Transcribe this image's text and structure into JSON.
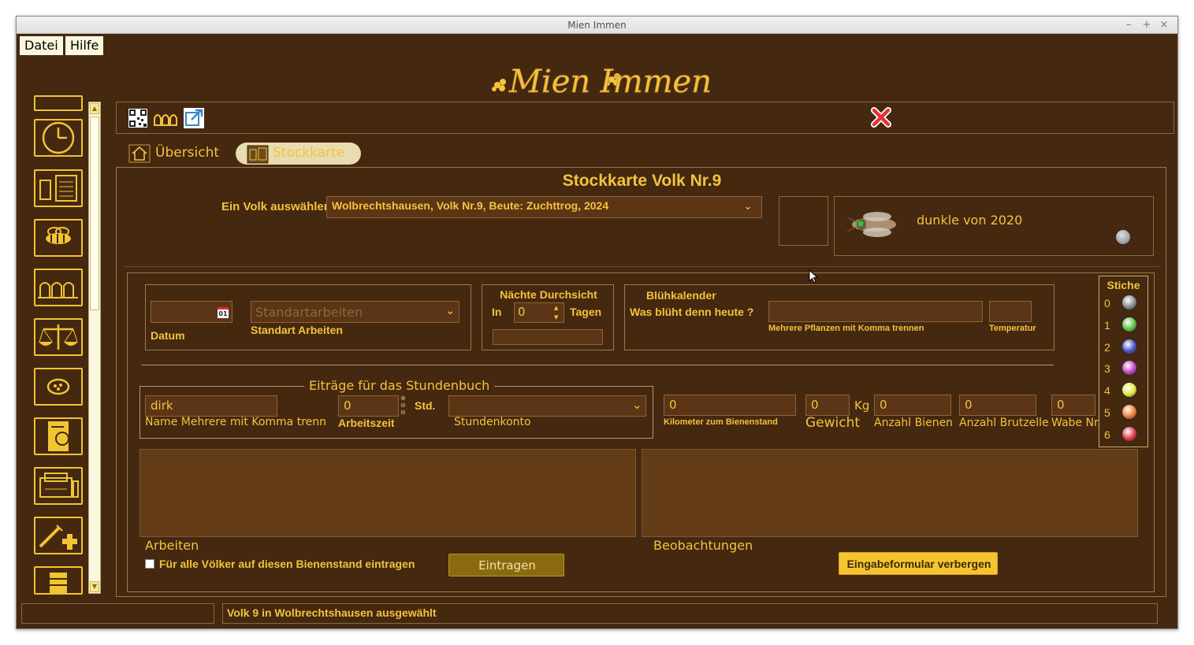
{
  "window": {
    "title": "Mien Immen",
    "min": "–",
    "max": "+",
    "close": "×"
  },
  "menu": {
    "file": "Datei",
    "help": "Hilfe"
  },
  "logo_text": "Mien Immen",
  "tabs": {
    "overview": "Übersicht",
    "stockcard": "Stockkarte"
  },
  "card": {
    "title": "Stockkarte Volk Nr.9",
    "select_label": "Ein Volk auswählen",
    "select_value": "Wolbrechtshausen, Volk Nr.9, Beute: Zuchttrog, 2024",
    "queen_label": "dunkle von 2020"
  },
  "form": {
    "date_label": "Datum",
    "date_icon_text": "01",
    "std_work_placeholder": "Standartarbeiten",
    "std_work_label": "Standart Arbeiten",
    "next_check_title": "Nächte Durchsicht",
    "in_label": "In",
    "days_value": "0",
    "days_label": "Tagen",
    "bloom_title": "Blühkalender",
    "bloom_question": "Was blüht denn heute ?",
    "plants_hint": "Mehrere Pflanzen mit Komma trennen",
    "temp_label": "Temperatur",
    "hours_legend": "Eiträge für das Stundenbuch",
    "name_value": "dirk",
    "name_label": "Name  Mehrere mit Komma trenn",
    "work_time_value": "0",
    "std_unit": "Std.",
    "work_time_label": "Arbeitszeit",
    "hour_account_label": "Stundenkonto",
    "km_value": "0",
    "km_label": "Kilometer zum Bienenstand",
    "weight_value": "0",
    "kg_unit": "Kg",
    "weight_label": "Gewicht",
    "bees_value": "0",
    "bees_label": "Anzahl Bienen",
    "brood_value": "0",
    "brood_label": "Anzahl Brutzellen",
    "comb_value": "0",
    "comb_label": "Wabe Nr.",
    "work_area_label": "Arbeiten",
    "obs_area_label": "Beobachtungen",
    "all_colonies_label": "Für alle Völker auf diesen Bienenstand eintragen",
    "submit_label": "Eintragen",
    "hide_form_label": "Eingabeformular verbergen"
  },
  "stings": {
    "title": "Stiche",
    "items": [
      {
        "n": "0",
        "color": "#8a8a8a"
      },
      {
        "n": "1",
        "color": "#5cc13c"
      },
      {
        "n": "2",
        "color": "#4a52c8"
      },
      {
        "n": "3",
        "color": "#c342c8"
      },
      {
        "n": "4",
        "color": "#e6e63c"
      },
      {
        "n": "5",
        "color": "#f07a2c"
      },
      {
        "n": "6",
        "color": "#e63448"
      }
    ]
  },
  "status": {
    "left": "",
    "message": "Volk 9 in Wolbrechtshausen ausgewählt"
  },
  "colors": {
    "background": "#452810",
    "gold": "#f3c33c",
    "field": "#5b3516",
    "cream": "#fbf6df"
  },
  "sidebar_icons": [
    "box-icon",
    "clock-icon",
    "book-icon",
    "bee-icon",
    "hives-icon",
    "scale-icon",
    "queen-icon",
    "hourbook-icon",
    "cashbox-icon",
    "medicine-icon",
    "honey-icon"
  ],
  "toolbar_icons": [
    "qr-code-icon",
    "hives-icon",
    "external-link-icon",
    "close-icon"
  ]
}
